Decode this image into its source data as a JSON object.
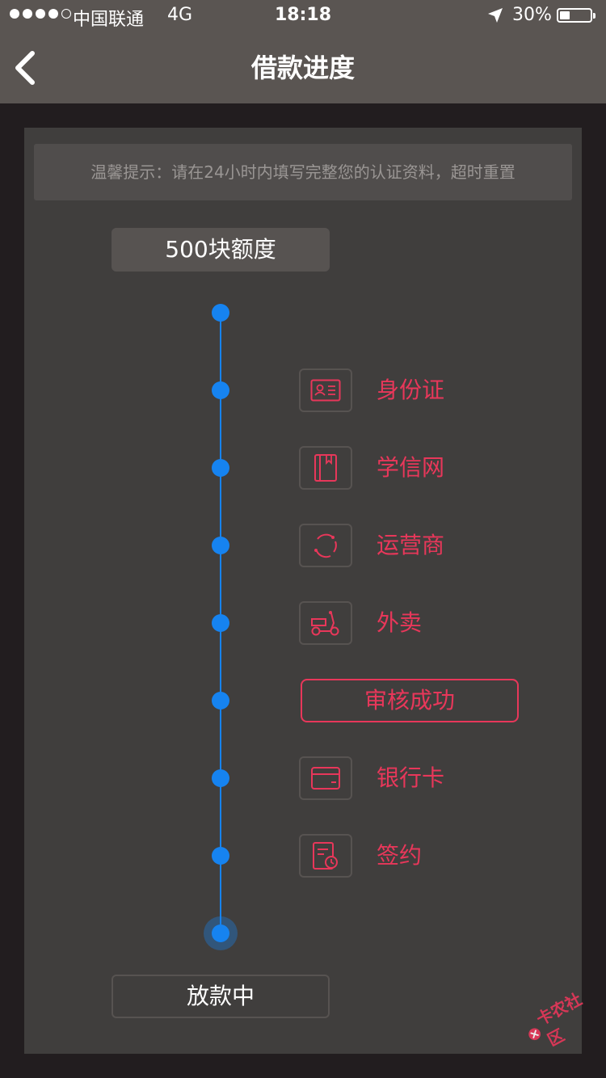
{
  "status_bar": {
    "carrier": "中国联通",
    "network": "4G",
    "time": "18:18",
    "battery_percent": "30%",
    "battery_level": 0.3
  },
  "nav": {
    "title": "借款进度",
    "back_icon": "chevron-left-icon"
  },
  "tip": "温馨提示：请在24小时内填写完整您的认证资料，超时重置",
  "credit_badge": "500块额度",
  "steps": [
    {
      "label": "身份证",
      "icon": "id-card-icon"
    },
    {
      "label": "学信网",
      "icon": "book-icon"
    },
    {
      "label": "运营商",
      "icon": "refresh-icon"
    },
    {
      "label": "外卖",
      "icon": "scooter-icon"
    },
    {
      "label": "银行卡",
      "icon": "bank-card-icon"
    },
    {
      "label": "签约",
      "icon": "contract-icon"
    }
  ],
  "review_status": "审核成功",
  "final_status": "放款中",
  "watermark": "卡农社区",
  "colors": {
    "accent_red": "#e8375a",
    "timeline_blue": "#1683f0",
    "panel_bg": "#403e3d",
    "nav_bg": "#5a5552"
  }
}
